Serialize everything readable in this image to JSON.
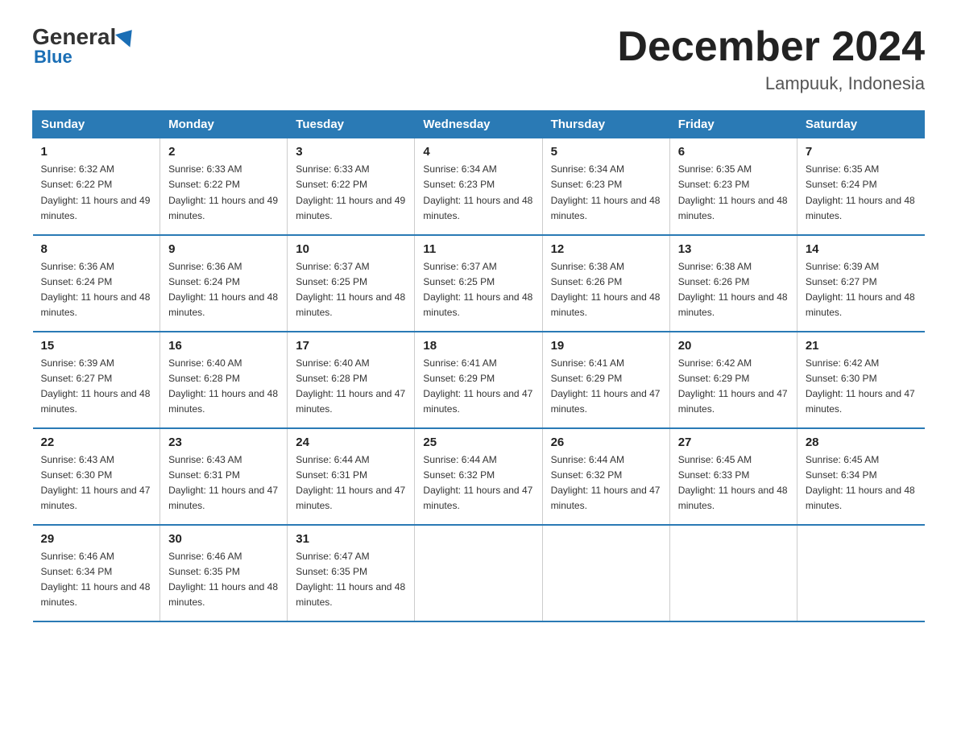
{
  "logo": {
    "general": "General",
    "blue": "Blue"
  },
  "title": "December 2024",
  "location": "Lampuuk, Indonesia",
  "days_of_week": [
    "Sunday",
    "Monday",
    "Tuesday",
    "Wednesday",
    "Thursday",
    "Friday",
    "Saturday"
  ],
  "weeks": [
    [
      {
        "day": "1",
        "sunrise": "6:32 AM",
        "sunset": "6:22 PM",
        "daylight": "11 hours and 49 minutes."
      },
      {
        "day": "2",
        "sunrise": "6:33 AM",
        "sunset": "6:22 PM",
        "daylight": "11 hours and 49 minutes."
      },
      {
        "day": "3",
        "sunrise": "6:33 AM",
        "sunset": "6:22 PM",
        "daylight": "11 hours and 49 minutes."
      },
      {
        "day": "4",
        "sunrise": "6:34 AM",
        "sunset": "6:23 PM",
        "daylight": "11 hours and 48 minutes."
      },
      {
        "day": "5",
        "sunrise": "6:34 AM",
        "sunset": "6:23 PM",
        "daylight": "11 hours and 48 minutes."
      },
      {
        "day": "6",
        "sunrise": "6:35 AM",
        "sunset": "6:23 PM",
        "daylight": "11 hours and 48 minutes."
      },
      {
        "day": "7",
        "sunrise": "6:35 AM",
        "sunset": "6:24 PM",
        "daylight": "11 hours and 48 minutes."
      }
    ],
    [
      {
        "day": "8",
        "sunrise": "6:36 AM",
        "sunset": "6:24 PM",
        "daylight": "11 hours and 48 minutes."
      },
      {
        "day": "9",
        "sunrise": "6:36 AM",
        "sunset": "6:24 PM",
        "daylight": "11 hours and 48 minutes."
      },
      {
        "day": "10",
        "sunrise": "6:37 AM",
        "sunset": "6:25 PM",
        "daylight": "11 hours and 48 minutes."
      },
      {
        "day": "11",
        "sunrise": "6:37 AM",
        "sunset": "6:25 PM",
        "daylight": "11 hours and 48 minutes."
      },
      {
        "day": "12",
        "sunrise": "6:38 AM",
        "sunset": "6:26 PM",
        "daylight": "11 hours and 48 minutes."
      },
      {
        "day": "13",
        "sunrise": "6:38 AM",
        "sunset": "6:26 PM",
        "daylight": "11 hours and 48 minutes."
      },
      {
        "day": "14",
        "sunrise": "6:39 AM",
        "sunset": "6:27 PM",
        "daylight": "11 hours and 48 minutes."
      }
    ],
    [
      {
        "day": "15",
        "sunrise": "6:39 AM",
        "sunset": "6:27 PM",
        "daylight": "11 hours and 48 minutes."
      },
      {
        "day": "16",
        "sunrise": "6:40 AM",
        "sunset": "6:28 PM",
        "daylight": "11 hours and 48 minutes."
      },
      {
        "day": "17",
        "sunrise": "6:40 AM",
        "sunset": "6:28 PM",
        "daylight": "11 hours and 47 minutes."
      },
      {
        "day": "18",
        "sunrise": "6:41 AM",
        "sunset": "6:29 PM",
        "daylight": "11 hours and 47 minutes."
      },
      {
        "day": "19",
        "sunrise": "6:41 AM",
        "sunset": "6:29 PM",
        "daylight": "11 hours and 47 minutes."
      },
      {
        "day": "20",
        "sunrise": "6:42 AM",
        "sunset": "6:29 PM",
        "daylight": "11 hours and 47 minutes."
      },
      {
        "day": "21",
        "sunrise": "6:42 AM",
        "sunset": "6:30 PM",
        "daylight": "11 hours and 47 minutes."
      }
    ],
    [
      {
        "day": "22",
        "sunrise": "6:43 AM",
        "sunset": "6:30 PM",
        "daylight": "11 hours and 47 minutes."
      },
      {
        "day": "23",
        "sunrise": "6:43 AM",
        "sunset": "6:31 PM",
        "daylight": "11 hours and 47 minutes."
      },
      {
        "day": "24",
        "sunrise": "6:44 AM",
        "sunset": "6:31 PM",
        "daylight": "11 hours and 47 minutes."
      },
      {
        "day": "25",
        "sunrise": "6:44 AM",
        "sunset": "6:32 PM",
        "daylight": "11 hours and 47 minutes."
      },
      {
        "day": "26",
        "sunrise": "6:44 AM",
        "sunset": "6:32 PM",
        "daylight": "11 hours and 47 minutes."
      },
      {
        "day": "27",
        "sunrise": "6:45 AM",
        "sunset": "6:33 PM",
        "daylight": "11 hours and 48 minutes."
      },
      {
        "day": "28",
        "sunrise": "6:45 AM",
        "sunset": "6:34 PM",
        "daylight": "11 hours and 48 minutes."
      }
    ],
    [
      {
        "day": "29",
        "sunrise": "6:46 AM",
        "sunset": "6:34 PM",
        "daylight": "11 hours and 48 minutes."
      },
      {
        "day": "30",
        "sunrise": "6:46 AM",
        "sunset": "6:35 PM",
        "daylight": "11 hours and 48 minutes."
      },
      {
        "day": "31",
        "sunrise": "6:47 AM",
        "sunset": "6:35 PM",
        "daylight": "11 hours and 48 minutes."
      },
      null,
      null,
      null,
      null
    ]
  ]
}
